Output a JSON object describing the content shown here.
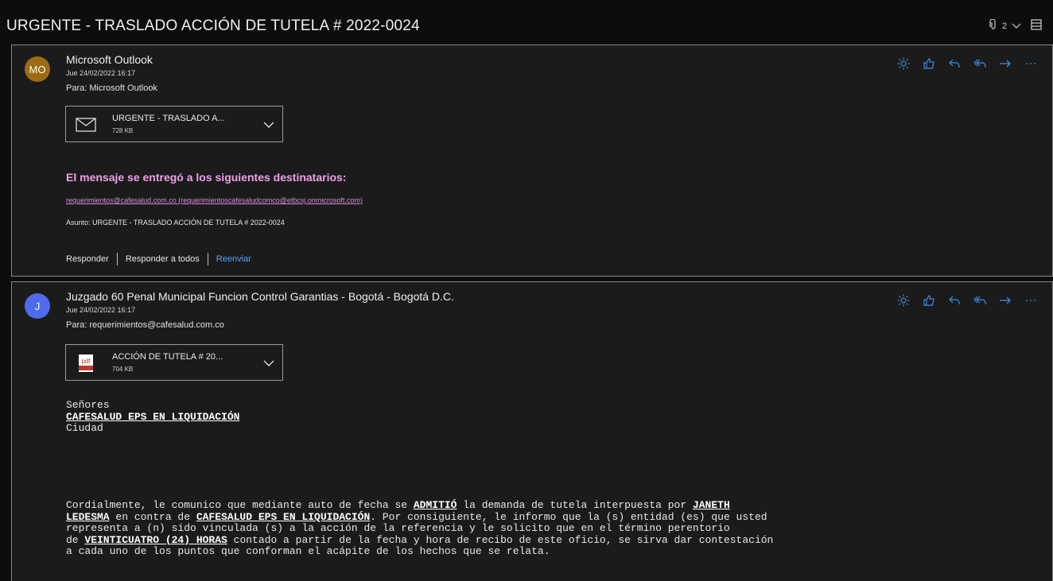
{
  "thread": {
    "subject": "URGENTE - TRASLADO ACCIÓN DE TUTELA # 2022-0024",
    "attachment_count": "2"
  },
  "messages": [
    {
      "avatar_initials": "MO",
      "avatar_color": "#9d6c12",
      "sender": "Microsoft Outlook",
      "date": "Jue 24/02/2022 16:17",
      "to": "Para: Microsoft Outlook",
      "attachment": {
        "name": "URGENTE - TRASLADO A...",
        "size": "728 KB",
        "icon": "envelope-icon"
      },
      "delivery_heading": "El mensaje se entregó a los siguientes destinatarios:",
      "delivery_recipient": "requerimientos@cafesalud.com.co (requerimientoscafesaludcomco@etbcsj.onmicrosoft.com)",
      "delivery_subject": "Asunto: URGENTE - TRASLADO ACCIÓN DE TUTELA # 2022-0024",
      "reply_actions": {
        "reply": "Responder",
        "reply_all": "Responder a todos",
        "forward": "Reenviar"
      }
    },
    {
      "avatar_initials": "J",
      "avatar_color": "#4f6bed",
      "sender": "Juzgado 60 Penal Municipal Funcion Control Garantias - Bogotá - Bogotá D.C.",
      "date": "Jue 24/02/2022 16:17",
      "to": "Para: requerimientos@cafesalud.com.co",
      "attachment": {
        "name": "ACCIÓN DE TUTELA # 20...",
        "size": "704 KB",
        "icon": "pdf-icon",
        "icon_label": "pdf"
      },
      "body": {
        "salutation": "Señores",
        "addressee": "CAFESALUD EPS EN LIQUIDACIÓN",
        "city": "Ciudad",
        "p1_a": "Cordialmente, le comunico que mediante auto de fecha se ",
        "p1_b": "ADMITIÓ",
        "p1_c": " la demanda de tutela interpuesta por ",
        "p1_d": "JANETH",
        "p2_a": "LEDESMA",
        "p2_b": " en contra de ",
        "p2_c": "CAFESALUD EPS EN LIQUIDACIÓN",
        "p2_d": ". Por consiguiente, le informo que la (s) entidad (es) que usted",
        "p3": "representa a (n) sido vinculada (s) a la acción de la referencia y le solicito que en el término perentorio",
        "p4_a": "de ",
        "p4_b": "VEINTICUATRO (24) HORAS",
        "p4_c": " contado a partir de la fecha y hora de recibo de este oficio, se sirva dar contestación",
        "p5": "a cada uno de los puntos que conforman el acápite de los hechos que se relata."
      }
    }
  ],
  "colors": {
    "background": "#0d0d0d",
    "message_bg": "#1b1b1b",
    "delivery_heading": "#f0a0e8",
    "link": "#d98be0",
    "forward": "#5aa0ff",
    "action_icons": "#3c8ce7"
  },
  "action_icons": [
    "sun-icon",
    "like-icon",
    "reply-icon",
    "reply-all-icon",
    "forward-icon",
    "more-icon"
  ]
}
